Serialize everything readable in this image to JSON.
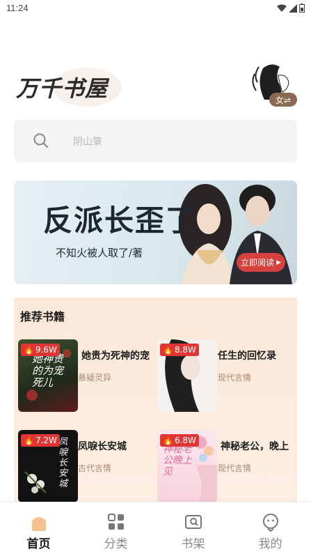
{
  "status_bar": {
    "time": "11:24"
  },
  "header": {
    "logo_text": "万千书屋",
    "gender_label": "女⇌"
  },
  "search": {
    "placeholder": "阴山箓"
  },
  "banner": {
    "title": "反派长歪了",
    "author": "不知火被人取了/著",
    "button_label": "立即阅读"
  },
  "recommend": {
    "title": "推荐书籍",
    "books": [
      {
        "title": "她贵为死神的宠",
        "genre": "悬疑灵异",
        "heat": "9.6W",
        "cover_text": "她神贵的为宠死儿"
      },
      {
        "title": "任生的回忆录",
        "genre": "现代言情",
        "heat": "8.8W",
        "cover_text": ""
      },
      {
        "title": "凤唳长安城",
        "genre": "古代言情",
        "heat": "7.2W",
        "cover_text": "凤唳长安城"
      },
      {
        "title": "神秘老公，晚上",
        "genre": "现代言情",
        "heat": "6.8W",
        "cover_text": "神秘老公晚上见"
      }
    ]
  },
  "tabbar": {
    "tabs": [
      {
        "label": "首页",
        "active": true
      },
      {
        "label": "分类",
        "active": false
      },
      {
        "label": "书架",
        "active": false
      },
      {
        "label": "我的",
        "active": false
      }
    ]
  },
  "colors": {
    "accent": "#f0c090",
    "heat_badge": "#e13434",
    "genre_text": "#a7896e",
    "banner_button": "#d6403f"
  }
}
